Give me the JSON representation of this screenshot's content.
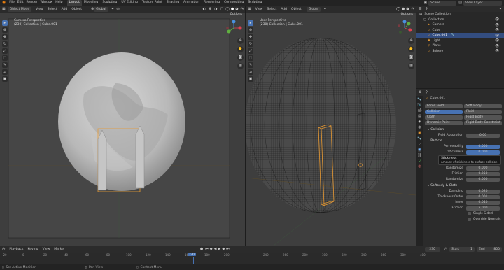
{
  "topbar": {
    "menus": [
      "File",
      "Edit",
      "Render",
      "Window",
      "Help"
    ],
    "workspaces": [
      "Layout",
      "Modeling",
      "Sculpting",
      "UV Editing",
      "Texture Paint",
      "Shading",
      "Animation",
      "Rendering",
      "Compositing",
      "Scripting"
    ],
    "active_workspace": "Layout",
    "scene": "Scene",
    "view_layer": "View Layer"
  },
  "left_viewport": {
    "mode": "Object Mode",
    "menus": [
      "View",
      "Select",
      "Add",
      "Object"
    ],
    "transform": "Global",
    "options": "Options",
    "title": "Camera Perspective",
    "subtitle": "(230) Collection | Cube.001"
  },
  "right_viewport": {
    "menus": [
      "View",
      "Select",
      "Add",
      "Object"
    ],
    "transform": "Global",
    "options": "Options",
    "title": "User Perspective",
    "subtitle": "(230) Collection | Cube.001"
  },
  "outliner": {
    "root": "Scene Collection",
    "items": [
      {
        "name": "Collection",
        "selected": false
      },
      {
        "name": "Camera",
        "selected": false
      },
      {
        "name": "Cube",
        "selected": false
      },
      {
        "name": "Cube.001",
        "selected": true
      },
      {
        "name": "Light",
        "selected": false
      },
      {
        "name": "Plane",
        "selected": false
      },
      {
        "name": "Sphere",
        "selected": false
      }
    ]
  },
  "properties": {
    "object_name": "Cube.001",
    "physics_buttons": [
      [
        "Force Field",
        "Soft Body"
      ],
      [
        "Collision",
        "Fluid"
      ],
      [
        "Cloth",
        "Rigid Body"
      ],
      [
        "Dynamic Paint",
        "Rigid Body Constraint"
      ]
    ],
    "collision_section": "Collision",
    "field_absorption_label": "Field Absorption",
    "field_absorption_value": "0.00",
    "particle_section": "Particle",
    "permeability_label": "Permeability",
    "permeability_value": "0.000",
    "stickiness_label": "Stickiness",
    "stickiness_value": "0.000",
    "tooltip_title": "Stickiness",
    "tooltip_body": "Amount of stickiness to surface collision",
    "randomize_label": "Randomize",
    "randomize_value": "0.000",
    "friction_label": "Friction",
    "friction_value": "0.250",
    "randomize2_label": "Randomize",
    "randomize2_value": "0.000",
    "softbody_section": "Softbody & Cloth",
    "damping_label": "Damping",
    "damping_value": "0.020",
    "thick_outer_label": "Thickness Outer",
    "thick_outer_value": "0.001",
    "inner_label": "Inner",
    "inner_value": "0.040",
    "friction2_label": "Friction",
    "friction2_value": "5.000",
    "single_sided_label": "Single Sided",
    "override_normals_label": "Override Normals"
  },
  "timeline": {
    "menus": [
      "Playback",
      "Keying",
      "View",
      "Marker"
    ],
    "current_frame": "230",
    "start_label": "Start",
    "start_value": "1",
    "end_label": "End",
    "end_value": "800",
    "ticks": [
      "-20",
      "0",
      "20",
      "40",
      "60",
      "80",
      "100",
      "120",
      "140",
      "160",
      "180",
      "200",
      "230",
      "240",
      "260",
      "280",
      "300",
      "320",
      "340",
      "360",
      "380",
      "400"
    ]
  },
  "statusbar": {
    "left": "Set Active Modifier",
    "mid1": "Pan View",
    "mid2": "Context Menu"
  },
  "colors": {
    "accent": "#4772b3",
    "selection_orange": "#e89a33",
    "frame_blue": "#4772b3"
  }
}
